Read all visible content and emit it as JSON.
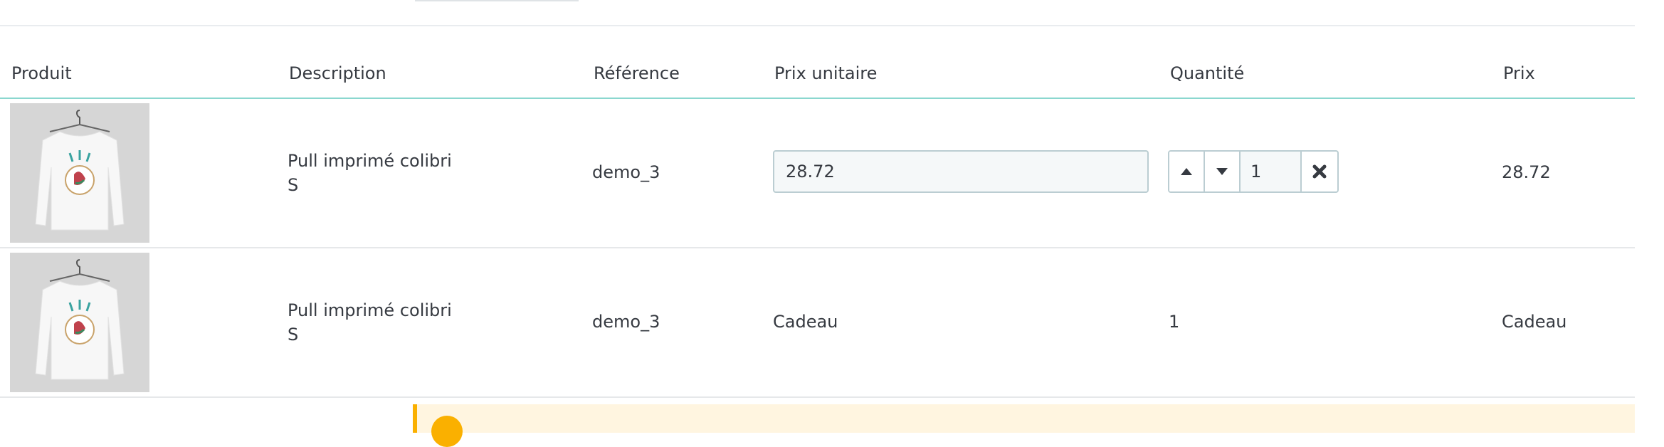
{
  "table": {
    "columns": {
      "product": "Produit",
      "description": "Description",
      "reference": "Référence",
      "unit_price": "Prix unitaire",
      "quantity": "Quantité",
      "price": "Prix"
    },
    "rows": [
      {
        "product_image": "long-sleeve-white-sweater-thumbnail",
        "description_line1": "Pull imprimé colibri",
        "description_line2": "S",
        "reference": "demo_3",
        "unit_price_value": "28.72",
        "quantity_value": "1",
        "price": "28.72"
      },
      {
        "product_image": "long-sleeve-white-sweater-thumbnail",
        "description_line1": "Pull imprimé colibri",
        "description_line2": "S",
        "reference": "demo_3",
        "unit_price": "Cadeau",
        "quantity": "1",
        "price": "Cadeau"
      }
    ]
  },
  "icons": {
    "increase": "caret-up-icon",
    "decrease": "caret-down-icon",
    "remove": "close-icon",
    "warning": "warning-icon"
  },
  "colors": {
    "header_rule": "#8ad7cf",
    "input_border": "#bbcdd2",
    "warning": "#fab000"
  }
}
